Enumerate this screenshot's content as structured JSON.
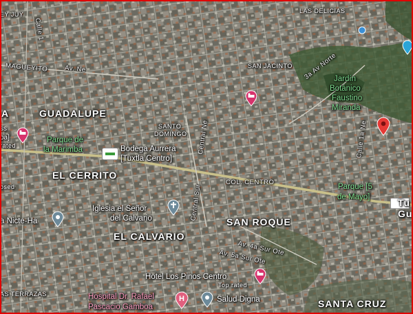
{
  "map": {
    "neighborhoods": {
      "guadalupe": "GUADALUPE",
      "el_cerrito": "EL CERRITO",
      "el_calvario": "EL CALVARIO",
      "san_roque": "SAN ROQUE",
      "santa_cruz": "SANTA CRUZ",
      "santo_domingo_1": "SANTO",
      "santo_domingo_2": "DOMINGO",
      "las_delicias": "LAS DELICIAS",
      "san_jacinto": "SAN JACINTO",
      "las_terrazas": "AS TERRAZAS",
      "hood_a": "A",
      "col_centro": "COL. CENTRO",
      "rey_juy": "EY JUY"
    },
    "streets": {
      "maguey": "MAGUEYITO",
      "av_ne_1": "Av. Ne",
      "calle_1": "Calle 1",
      "central_sur": "Central Sur",
      "central_norte": "Central Ne",
      "av_norte": "3a Av Norte",
      "calle_norte": "Calle 1a Ne",
      "av_4a_sur": "Av. 4a Sur Ote",
      "av_5a_sur": "Av. 5a Sur Ote"
    },
    "places": {
      "parque_marimba_1": "Parque de",
      "parque_marimba_2": "la Marimba",
      "bodega_1": "Bodega Aurrera",
      "bodega_2": "[Tuxtla Centro]",
      "iglesia_1": "Iglesia el Señor",
      "iglesia_2": "del Calvario",
      "nicte_ha": "a Nicte-Ha",
      "jardin_1": "Jardín",
      "jardin_2": "Botánico",
      "jardin_3": "Faustino",
      "jardin_4": "Miranda",
      "parque5_1": "Parque [5",
      "parque5_2": "de Mayo]",
      "hotel_1": "Hotel Los Pinos Centro",
      "hotel_2": "Top rated",
      "hospital_1": "Hospital Dr. Rafael",
      "hospital_2": "Pascacio Gamboa",
      "salud": "Salud Digna",
      "left_1": "ss",
      "left_2": "pa]",
      "left_3": "rated",
      "left_4": "osed",
      "tux_1": "Tu",
      "tux_2": "Guti"
    },
    "icons": {
      "hotel_pin": "hotel-bed-icon",
      "place_pin": "place-pin-icon",
      "hospital_pin": "hospital-icon",
      "church_pin": "church-icon",
      "shop_pin": "store-icon",
      "location_pin": "red-location-pin-icon",
      "water_pin": "water-drop-icon"
    },
    "colors": {
      "hotel": "#d6336c",
      "place": "#6d8a9a",
      "red_pin": "#e53935",
      "frame": "#e00000",
      "park_label": "#7fdc8f"
    }
  }
}
